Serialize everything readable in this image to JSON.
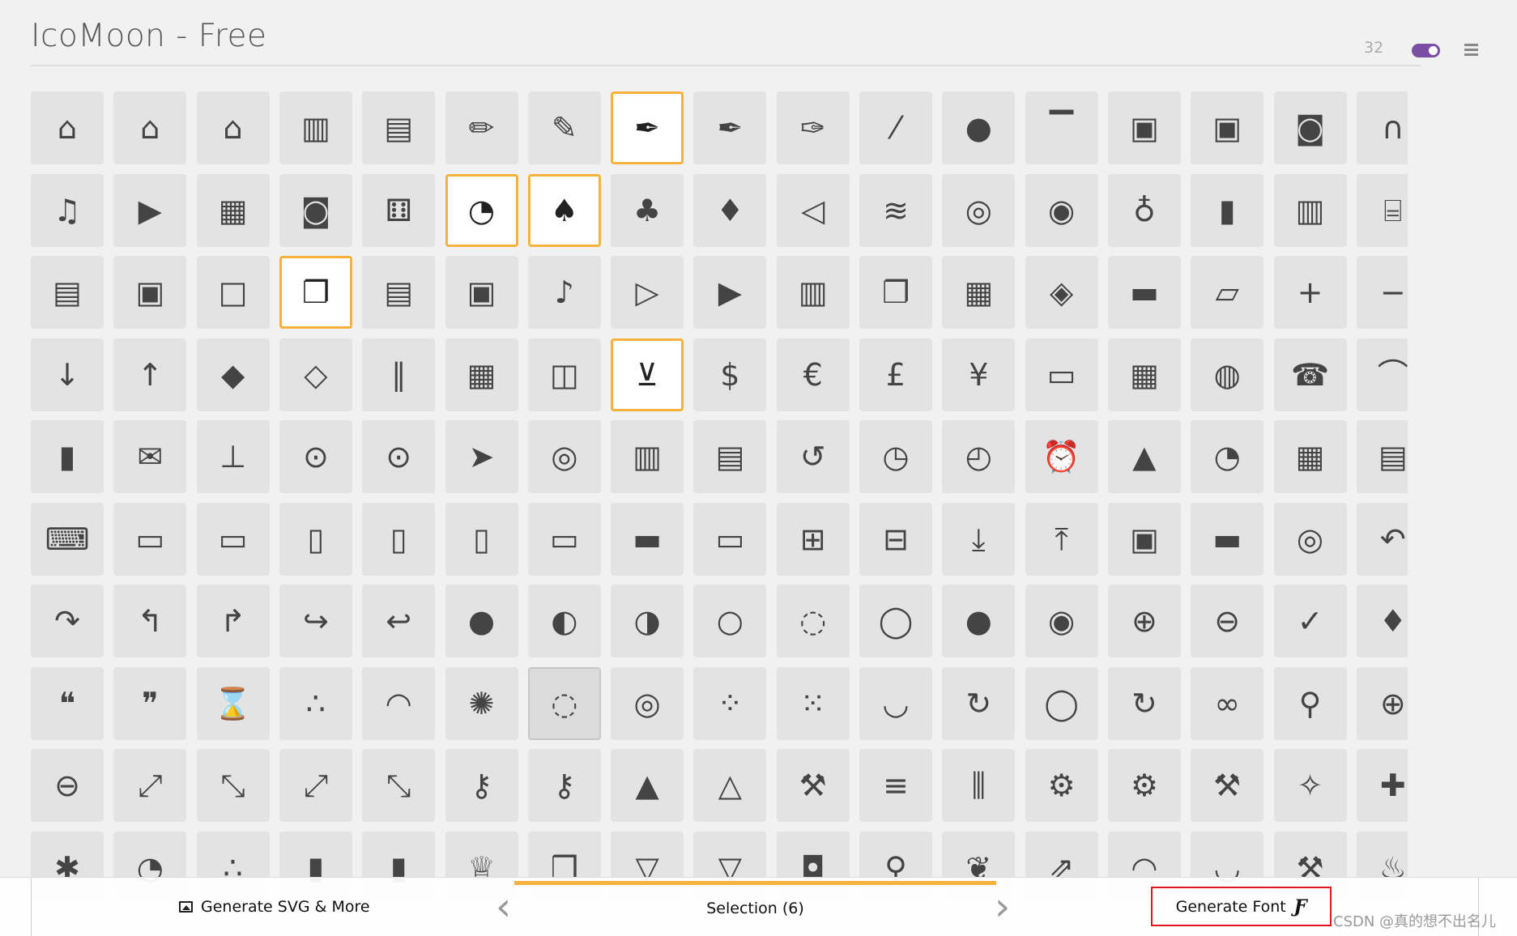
{
  "header": {
    "title": "IcoMoon - Free",
    "icon_size_value": "32",
    "toggle_color": "#7a4fa3"
  },
  "colors": {
    "selected_border": "#f6b23a",
    "tile_bg": "#e3e3e3",
    "highlight_box": "#e0191f"
  },
  "icons": [
    [
      "home",
      "home2",
      "home3",
      "office",
      "newspaper",
      "pencil",
      "pencil2",
      "quill",
      "pen",
      "blog",
      "eyedropper",
      "droplet",
      "paint-format",
      "image",
      "images",
      "camera",
      "headphones"
    ],
    [
      "music",
      "play",
      "film",
      "video-camera",
      "dice",
      "pacman",
      "spades",
      "clubs",
      "diamonds",
      "bullhorn",
      "connection",
      "podcast",
      "feed",
      "mic",
      "book",
      "books",
      "library"
    ],
    [
      "file-text",
      "profile",
      "file-empty",
      "files-empty",
      "file-text2",
      "file-picture",
      "file-music",
      "file-play",
      "file-video",
      "file-zip",
      "copy",
      "paste",
      "stack",
      "folder",
      "folder-open",
      "folder-plus",
      "folder-minus"
    ],
    [
      "folder-download",
      "folder-upload",
      "price-tag",
      "price-tags",
      "barcode",
      "qrcode",
      "ticket",
      "cart",
      "coin-dollar",
      "coin-euro",
      "coin-pound",
      "coin-yen",
      "credit-card",
      "calculator",
      "lifebuoy",
      "phone",
      "phone-hang-up"
    ],
    [
      "address-book",
      "envelop",
      "pushpin",
      "location",
      "location2",
      "compass",
      "compass2",
      "map",
      "map2",
      "history",
      "clock",
      "clock2",
      "alarm",
      "bell",
      "stopwatch",
      "calendar",
      "printer"
    ],
    [
      "keyboard",
      "display",
      "laptop",
      "mobile",
      "mobile2",
      "tablet",
      "tv",
      "drawer",
      "drawer2",
      "box-add",
      "box-remove",
      "download",
      "upload",
      "floppy-disk",
      "drive",
      "database",
      "undo"
    ],
    [
      "redo",
      "undo2",
      "redo2",
      "forward",
      "reply",
      "bubble",
      "bubbles",
      "bubbles2",
      "bubble2",
      "bubbles3",
      "bubbles4",
      "user",
      "users",
      "user-plus",
      "user-minus",
      "user-check",
      "user-tie"
    ],
    [
      "quotes-left",
      "quotes-right",
      "hour-glass",
      "spinner",
      "spinner2",
      "spinner3",
      "spinner4",
      "spinner5",
      "spinner6",
      "spinner7",
      "spinner8",
      "spinner9",
      "spinner10",
      "spinner11",
      "binoculars",
      "search",
      "zoom-in"
    ],
    [
      "zoom-out",
      "enlarge",
      "shrink",
      "enlarge2",
      "shrink2",
      "key",
      "key2",
      "lock",
      "unlocked",
      "wrench",
      "equalizer",
      "equalizer2",
      "cog",
      "cogs",
      "hammer",
      "magic-wand",
      "aid-kit"
    ],
    [
      "bug",
      "pie-chart",
      "stats-dots",
      "stats-bars",
      "stats-bars2",
      "trophy",
      "gift",
      "glass",
      "glass2",
      "mug",
      "spoon-knife",
      "leaf",
      "rocket",
      "meter",
      "meter2",
      "hammer2",
      "fire"
    ]
  ],
  "selected_icons": [
    "quill",
    "pacman",
    "spades",
    "files-empty",
    "cart",
    "spinner4"
  ],
  "hover_icon": "spinner4",
  "bottom_bar": {
    "generate_svg_label": "Generate SVG & More",
    "selection_label": "Selection (6)",
    "generate_font_label": "Generate Font",
    "font_glyph": "Ƒ"
  },
  "watermark": "CSDN @真的想不出名儿"
}
